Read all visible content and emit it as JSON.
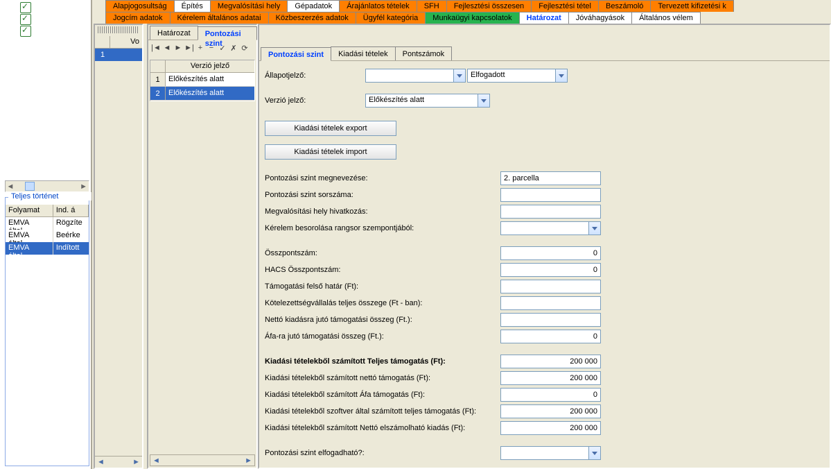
{
  "top_tabs_row1": [
    {
      "label": "Alapjogosultság",
      "cls": "orange"
    },
    {
      "label": "Építés",
      "cls": "white"
    },
    {
      "label": "Megvalósítási hely",
      "cls": "orange"
    },
    {
      "label": "Gépadatok",
      "cls": "white"
    },
    {
      "label": "Árajánlatos tételek",
      "cls": "orange"
    },
    {
      "label": "SFH",
      "cls": "orange"
    },
    {
      "label": "Fejlesztési összesen",
      "cls": "orange"
    },
    {
      "label": "Fejlesztési tétel",
      "cls": "orange"
    },
    {
      "label": "Beszámoló",
      "cls": "orange"
    },
    {
      "label": "Tervezett kifizetési k",
      "cls": "orange"
    }
  ],
  "top_tabs_row2": [
    {
      "label": "Jogcím adatok",
      "cls": "orange"
    },
    {
      "label": "Kérelem általános adatai",
      "cls": "orange"
    },
    {
      "label": "Közbeszerzés adatok",
      "cls": "orange"
    },
    {
      "label": "Ügyfél kategória",
      "cls": "orange"
    },
    {
      "label": "Munkaügyi kapcsolatok",
      "cls": "green"
    },
    {
      "label": "Határozat",
      "cls": "active-blue"
    },
    {
      "label": "Jóváhagyások",
      "cls": "white"
    },
    {
      "label": "Általános vélem",
      "cls": "white"
    }
  ],
  "history": {
    "legend": "Teljes történet",
    "cols": [
      "Folyamat",
      "Ind. á"
    ],
    "rows": [
      {
        "c1": "EMVA által...",
        "c2": "Rögzíte"
      },
      {
        "c1": "EMVA által...",
        "c2": "Beérke"
      },
      {
        "c1": "EMVA által...",
        "c2": "Indított",
        "sel": true
      }
    ]
  },
  "mid": {
    "header": "Vo",
    "row_num": "1"
  },
  "ver_pane": {
    "tabs": [
      "Határozat",
      "Pontozási szint"
    ],
    "active": 1,
    "nav_icons": [
      "|◄",
      "◄",
      "►",
      "►|",
      "+",
      "−",
      "✓",
      "✗",
      "⟳"
    ],
    "col": "Verzió jelző",
    "rows": [
      {
        "n": "1",
        "v": "Előkészítés alatt"
      },
      {
        "n": "2",
        "v": "Előkészítés alatt",
        "sel": true
      }
    ]
  },
  "main": {
    "sub_tabs": [
      "Pontozási szint",
      "Kiadási tételek",
      "Pontszámok"
    ],
    "active": 0,
    "fields": {
      "allapotjelzo_label": "Állapotjelző:",
      "allapotjelzo_sel1": "",
      "allapotjelzo_sel2": "Elfogadott",
      "verz_label": "Verzió jelző:",
      "verz_val": "Előkészítés alatt",
      "btn_export": "Kiadási tételek export",
      "btn_import": "Kiadási tételek import",
      "pont_megnev_label": "Pontozási szint megnevezése:",
      "pont_megnev_val": "2. parcella",
      "pont_sorszam_label": "Pontozási szint sorszáma:",
      "pont_sorszam_val": "",
      "megval_hiv_label": "Megvalósítási hely hivatkozás:",
      "megval_hiv_val": "",
      "kerelem_besor_label": "Kérelem besorolása rangsor szempontjából:",
      "ossz_label": "Összpontszám:",
      "ossz_val": "0",
      "hacs_label": "HACS Összpontszám:",
      "hacs_val": "0",
      "tam_felso_label": "Támogatási felső határ (Ft):",
      "tam_felso_val": "",
      "kotelez_label": "Kötelezettségvállalás teljes összege (Ft - ban):",
      "kotelez_val": "",
      "netto_kiad_label": "Nettó kiadásra jutó támogatási összeg (Ft.):",
      "netto_kiad_val": "",
      "afa_tam_label": "Áfa-ra jutó támogatási összeg (Ft.):",
      "afa_tam_val": "0",
      "kt_teljes_label": "Kiadási tételekből számított Teljes támogatás (Ft):",
      "kt_teljes_val": "200 000",
      "kt_netto_label": "Kiadási tételekből számított nettó támogatás (Ft):",
      "kt_netto_val": "200 000",
      "kt_afa_label": "Kiadási tételekből számított Áfa támogatás (Ft):",
      "kt_afa_val": "0",
      "kt_szoftver_label": "Kiadási tételekből szoftver által számított teljes támogatás (Ft):",
      "kt_szoftver_val": "200 000",
      "kt_netto_elsz_label": "Kiadási tételekből számított Nettó elszámolható kiadás (Ft):",
      "kt_netto_elsz_val": "200 000",
      "elfogad_label": "Pontozási szint elfogadható?:"
    }
  }
}
